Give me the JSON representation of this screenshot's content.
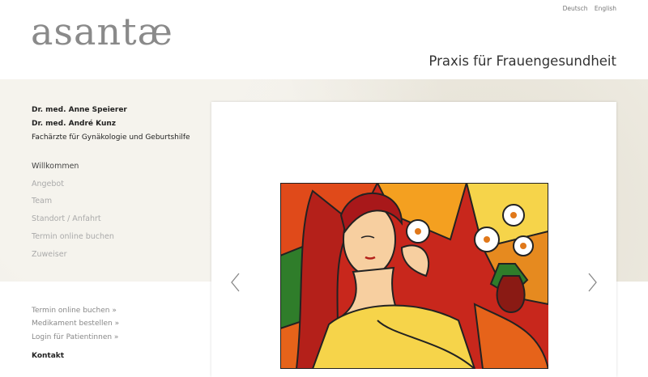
{
  "header": {
    "logo": "asantæ",
    "languages": [
      "Deutsch",
      "English"
    ],
    "tagline": "Praxis für Frauengesundheit"
  },
  "doctors": {
    "name1": "Dr. med. Anne Speierer",
    "name2": "Dr. med. André Kunz",
    "specialty": "Fachärzte für Gynäkologie und Geburtshilfe"
  },
  "nav": {
    "items": [
      "Willkommen",
      "Angebot",
      "Team",
      "Standort / Anfahrt",
      "Termin online buchen",
      "Zuweiser"
    ]
  },
  "quick_links": [
    "Termin online buchen »",
    "Medikament bestellen »",
    "Login für Patientinnen »"
  ],
  "contact": {
    "heading": "Kontakt"
  },
  "slider": {
    "image": "stained-glass-woman-with-flowers"
  },
  "colors": {
    "band": "#f0ede4",
    "text": "#333333",
    "muted": "#aaaaaa"
  }
}
